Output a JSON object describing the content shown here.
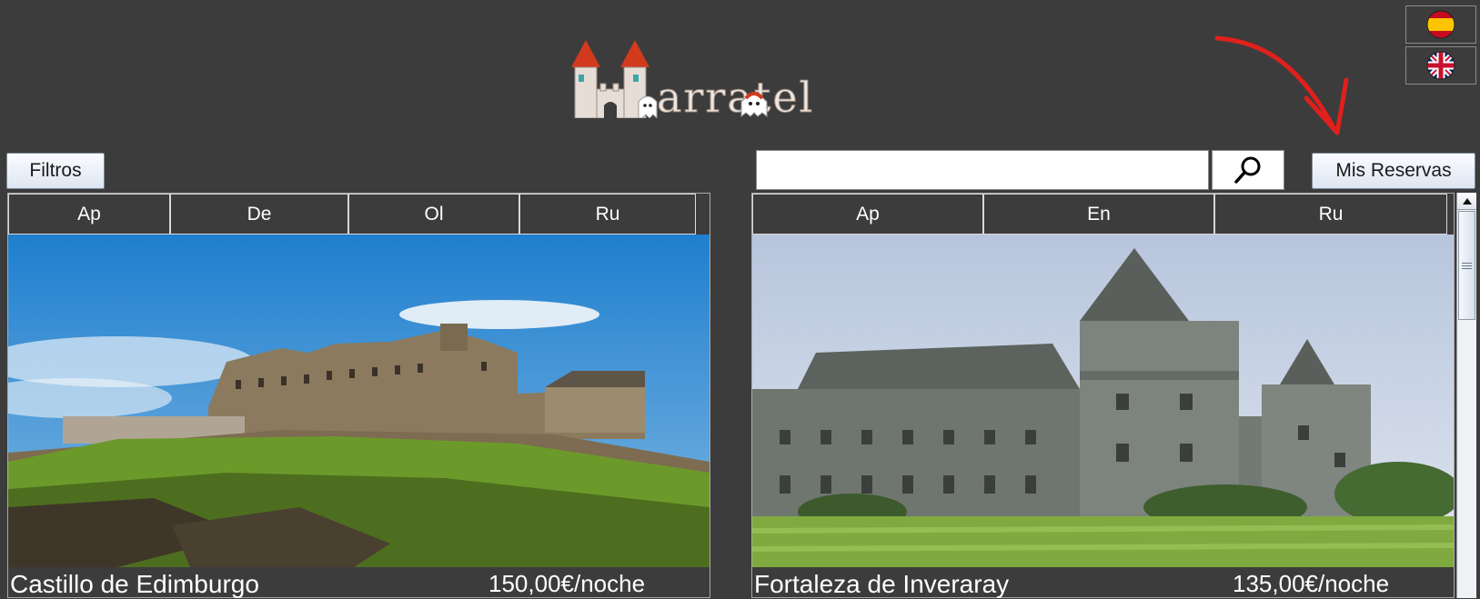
{
  "app": {
    "logo_text": "arratel"
  },
  "languages": [
    {
      "name": "es",
      "icon": "spain-flag-icon"
    },
    {
      "name": "en",
      "icon": "uk-flag-icon"
    }
  ],
  "toolbar": {
    "filters_label": "Filtros",
    "reservations_label": "Mis Reservas",
    "search_value": "",
    "search_icon": "search-icon"
  },
  "listings": [
    {
      "tags": [
        "Ap",
        "De",
        "Ol",
        "Ru"
      ],
      "name": "Castillo de Edimburgo",
      "price": "150,00€/noche"
    },
    {
      "tags": [
        "Ap",
        "En",
        "Ru"
      ],
      "name": "Fortaleza de Inveraray",
      "price": "135,00€/noche"
    }
  ],
  "colors": {
    "background": "#3c3c3c",
    "annotation_arrow": "#e0201c"
  }
}
